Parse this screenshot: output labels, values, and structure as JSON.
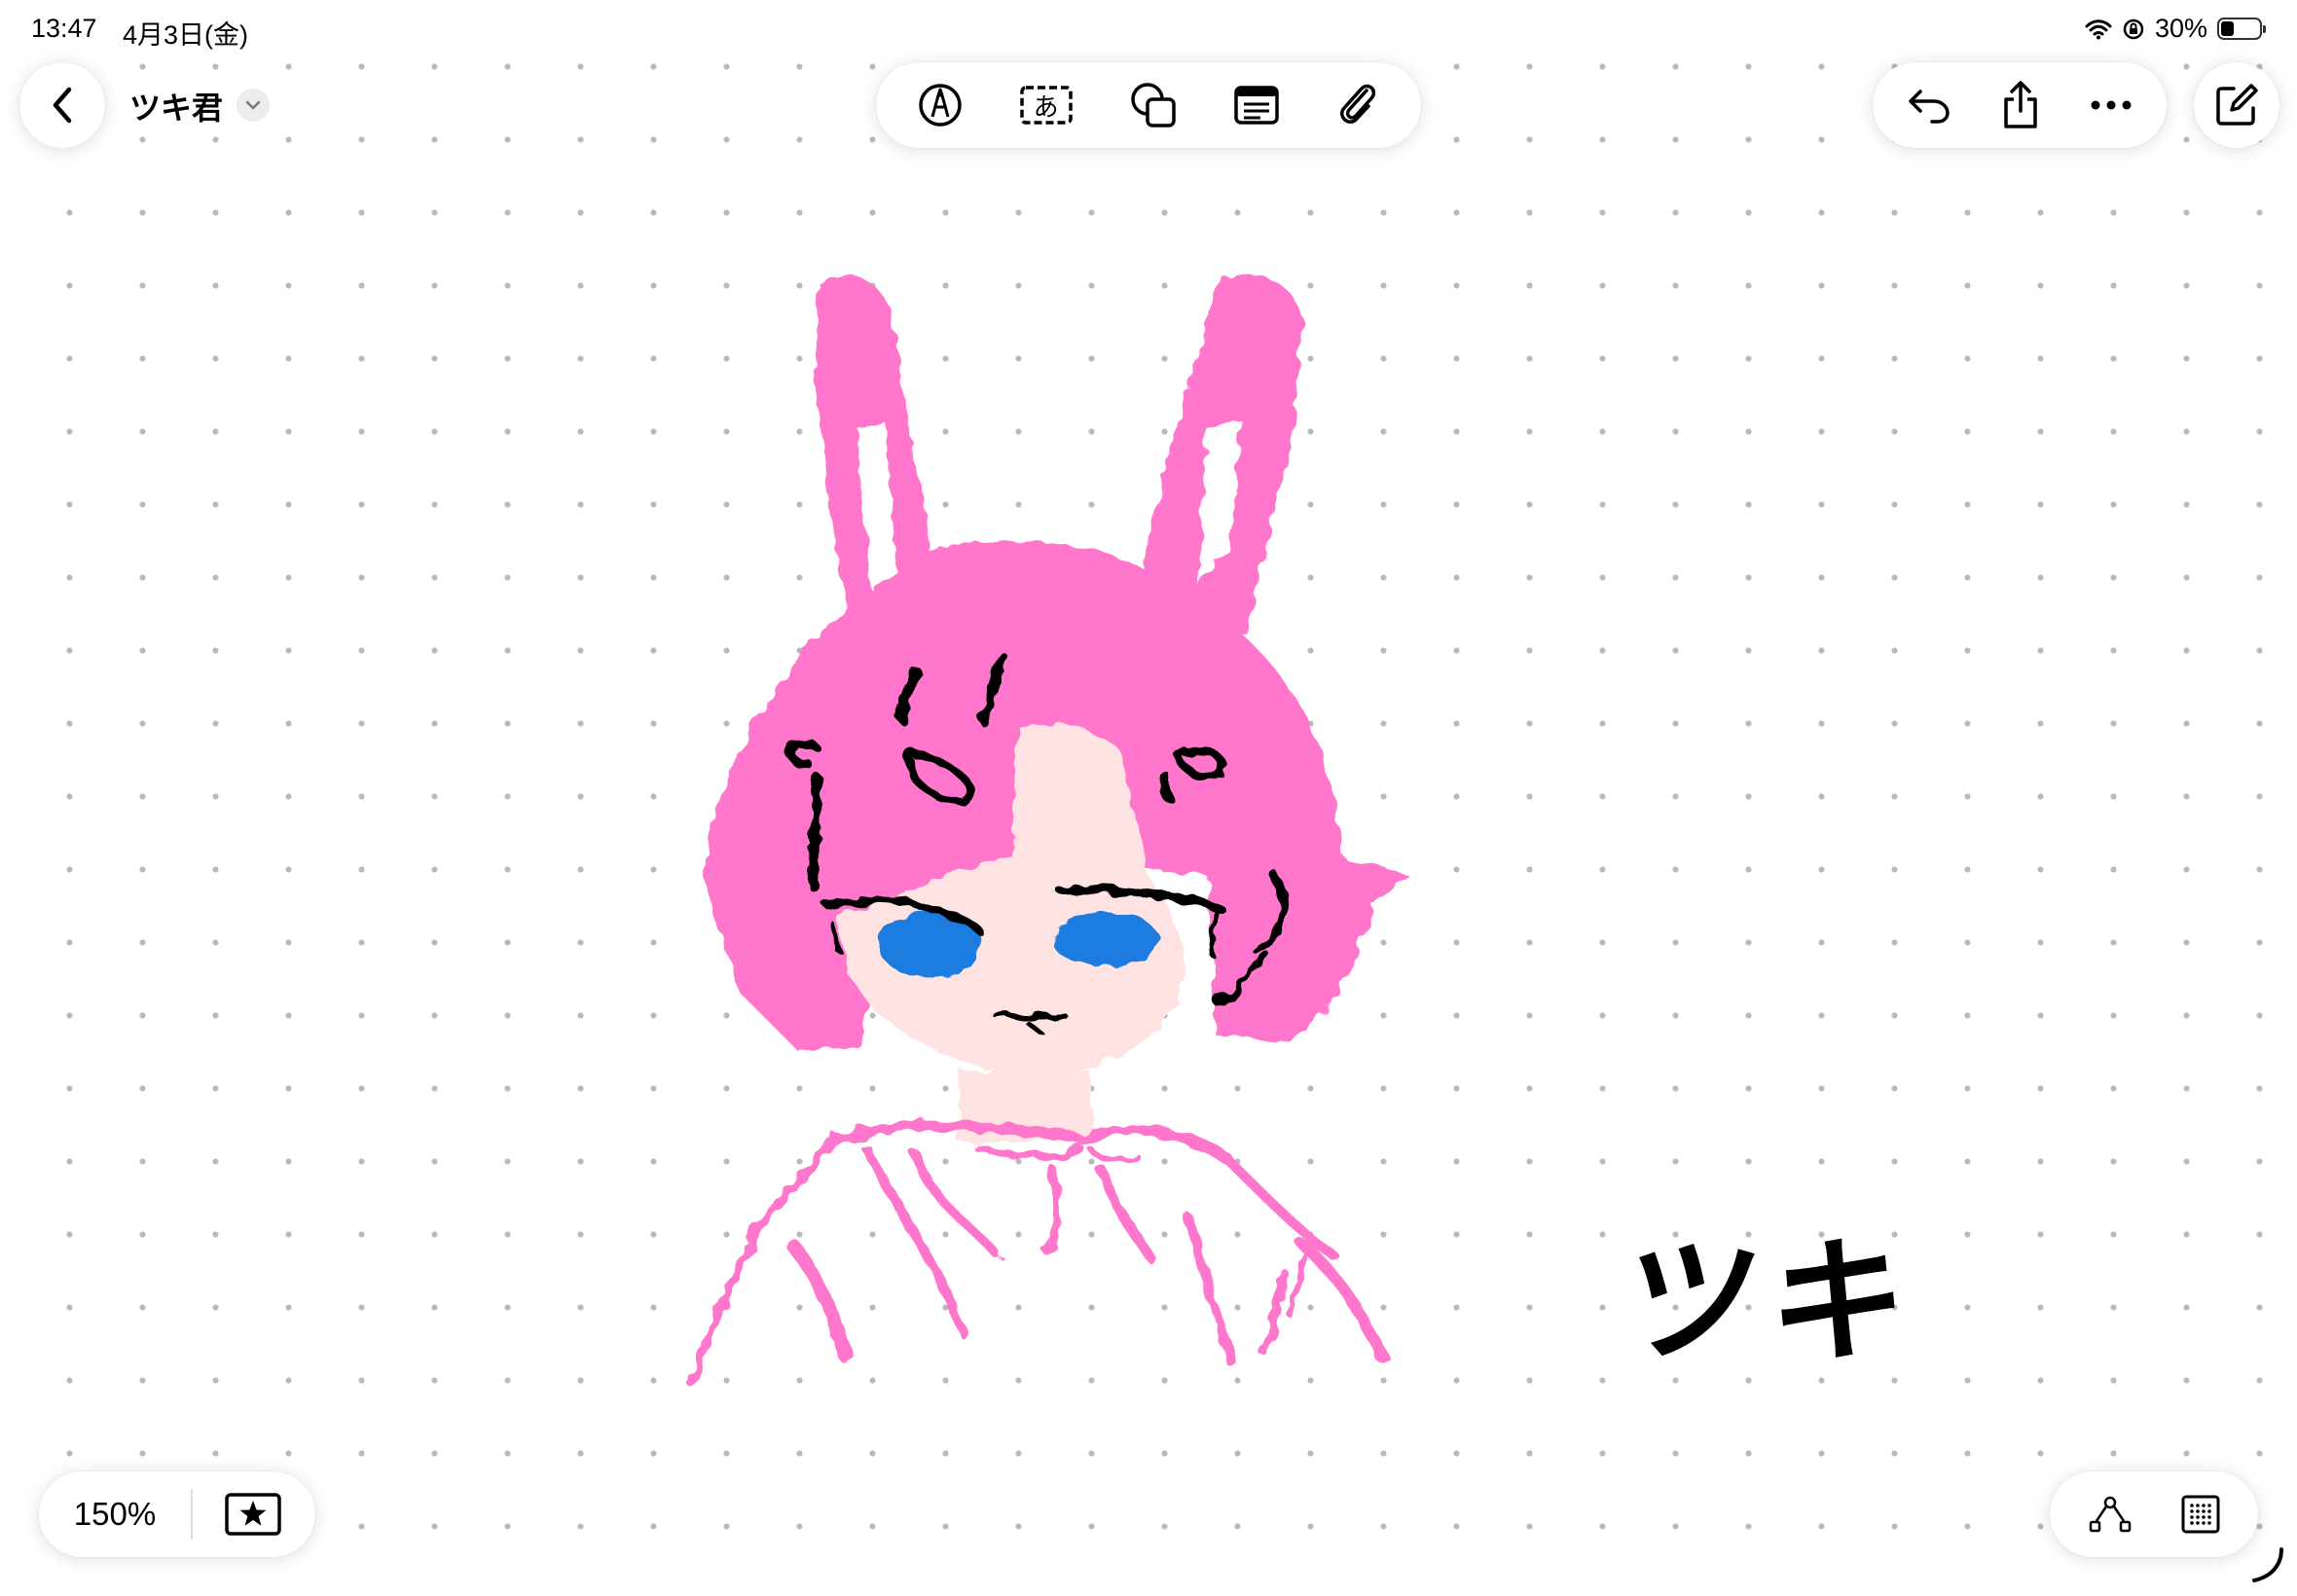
{
  "status_bar": {
    "time": "13:47",
    "date": "4月3日(金)",
    "battery_percent_label": "30%",
    "battery_level": 0.3
  },
  "header": {
    "document_title": "ツキ君"
  },
  "toolbar": {
    "tools": [
      {
        "icon": "pen-circle-icon"
      },
      {
        "icon": "text-box-icon",
        "glyph": "あ"
      },
      {
        "icon": "shapes-icon"
      },
      {
        "icon": "note-card-icon"
      },
      {
        "icon": "paperclip-icon"
      }
    ]
  },
  "right_toolbar": {
    "tools": [
      {
        "icon": "undo-icon"
      },
      {
        "icon": "share-icon"
      },
      {
        "icon": "more-icon"
      }
    ],
    "compose": {
      "icon": "compose-icon"
    }
  },
  "footer": {
    "zoom_level": "150%",
    "favorite_icon": "star-box-icon",
    "right_icons": [
      "connector-icon",
      "grid-icon"
    ]
  },
  "canvas": {
    "grid": "dots",
    "handwritten_text": "ツキ",
    "colors": {
      "hair": "#ff77cc",
      "skin": "#ffe3e3",
      "eyes": "#1a7be0",
      "ink": "#000000",
      "grid_dot": "#b9b9b9"
    }
  }
}
